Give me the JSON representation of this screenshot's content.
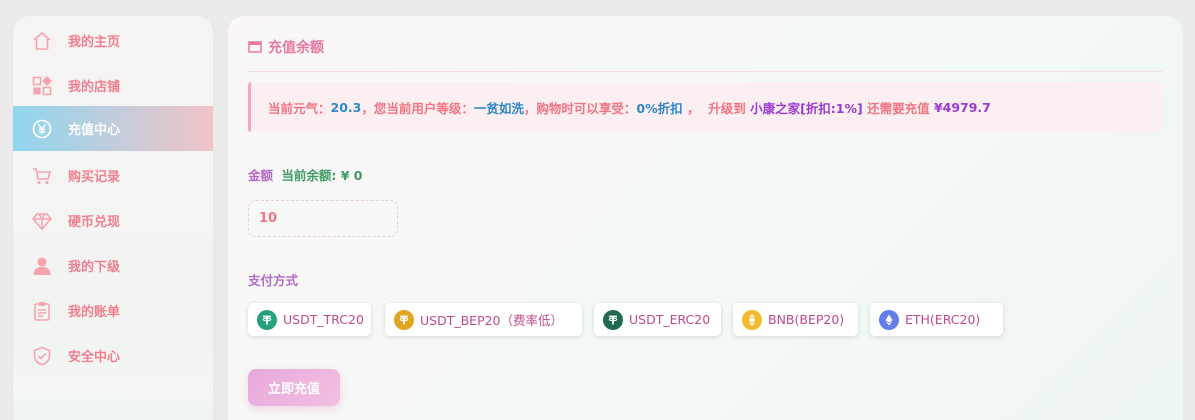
{
  "sidebar": {
    "items": [
      {
        "label": "我的主页",
        "icon": "home-icon"
      },
      {
        "label": "我的店铺",
        "icon": "apps-icon"
      },
      {
        "label": "充值中心",
        "icon": "yen-icon",
        "active": true
      },
      {
        "label": "购买记录",
        "icon": "cart-icon"
      },
      {
        "label": "硬币兑现",
        "icon": "diamond-icon"
      },
      {
        "label": "我的下级",
        "icon": "user-icon"
      },
      {
        "label": "我的账单",
        "icon": "clipboard-icon"
      },
      {
        "label": "安全中心",
        "icon": "shield-icon"
      }
    ]
  },
  "main": {
    "title": "充值余额",
    "notice": {
      "p1": "当前元气：",
      "energy": "20.3",
      "p2": "，您当前用户等级：",
      "level": "一贫如洗",
      "p3": "，购物时可以享受：",
      "discount": "0%折扣",
      "p4": " ，  升级到 ",
      "next_level": "小康之家[折扣:1%]",
      "p5": " 还需要充值 ",
      "need": "¥4979.7"
    },
    "amount_label": "金额",
    "balance_label": "当前余额: ¥ 0",
    "amount_value": "10",
    "pay_label": "支付方式",
    "pay_methods": [
      {
        "label": "USDT_TRC20",
        "icon": "tether-icon",
        "color": "#26a17b"
      },
      {
        "label": "USDT_BEP20（费率低）",
        "icon": "tether-bsc-icon",
        "color": "#e1a520"
      },
      {
        "label": "USDT_ERC20",
        "icon": "tether-erc-icon",
        "color": "#1f6b52"
      },
      {
        "label": "BNB(BEP20)",
        "icon": "bnb-icon",
        "color": "#f3ba2f"
      },
      {
        "label": "ETH(ERC20)",
        "icon": "eth-icon",
        "color": "#627eea"
      }
    ],
    "submit_label": "立即充值"
  },
  "colors": {
    "accent_pink": "#e878a2",
    "label_red": "#f07684",
    "value_blue": "#2f87c8",
    "value_purple": "#9a3bd0",
    "balance_green": "#3d9a63",
    "active_gradient_start": "#8fd6ee",
    "active_gradient_end": "#f2c3c8"
  }
}
